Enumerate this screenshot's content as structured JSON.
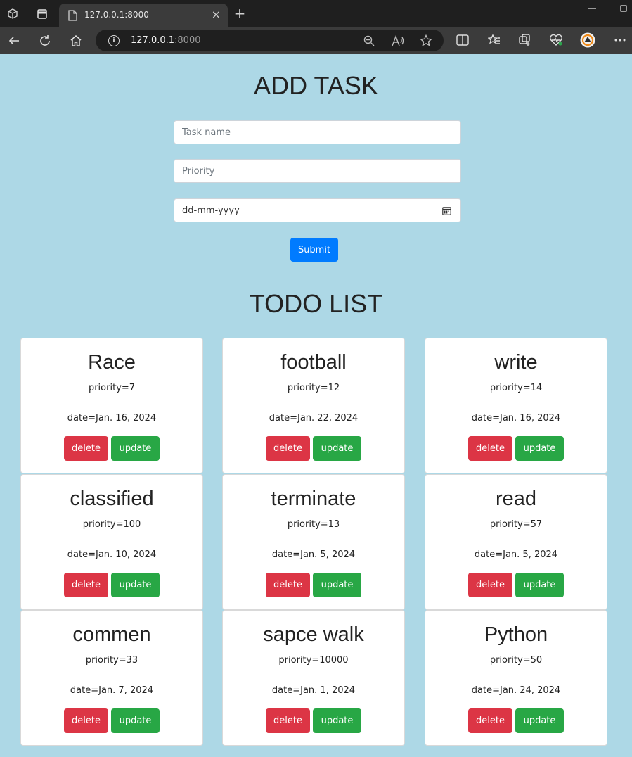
{
  "browser": {
    "tab_title": "127.0.0.1:8000",
    "tab_close": "×",
    "new_tab": "+",
    "url_host": "127.0.0.1",
    "url_port": ":8000",
    "info_icon": "i",
    "accent_color": "#007bff"
  },
  "add_task": {
    "heading": "ADD TASK",
    "task_name_placeholder": "Task name",
    "priority_placeholder": "Priority",
    "date_value": "dd-mm-yyyy",
    "submit_label": "Submit"
  },
  "todo": {
    "heading": "TODO LIST",
    "delete_label": "delete",
    "update_label": "update",
    "tasks": [
      {
        "name": "Race",
        "priority": "priority=7",
        "date": "date=Jan. 16, 2024"
      },
      {
        "name": "football",
        "priority": "priority=12",
        "date": "date=Jan. 22, 2024"
      },
      {
        "name": "write",
        "priority": "priority=14",
        "date": "date=Jan. 16, 2024"
      },
      {
        "name": "classified",
        "priority": "priority=100",
        "date": "date=Jan. 10, 2024"
      },
      {
        "name": "terminate",
        "priority": "priority=13",
        "date": "date=Jan. 5, 2024"
      },
      {
        "name": "read",
        "priority": "priority=57",
        "date": "date=Jan. 5, 2024"
      },
      {
        "name": "commen",
        "priority": "priority=33",
        "date": "date=Jan. 7, 2024"
      },
      {
        "name": "sapce walk",
        "priority": "priority=10000",
        "date": "date=Jan. 1, 2024"
      },
      {
        "name": "Python",
        "priority": "priority=50",
        "date": "date=Jan. 24, 2024"
      }
    ]
  }
}
